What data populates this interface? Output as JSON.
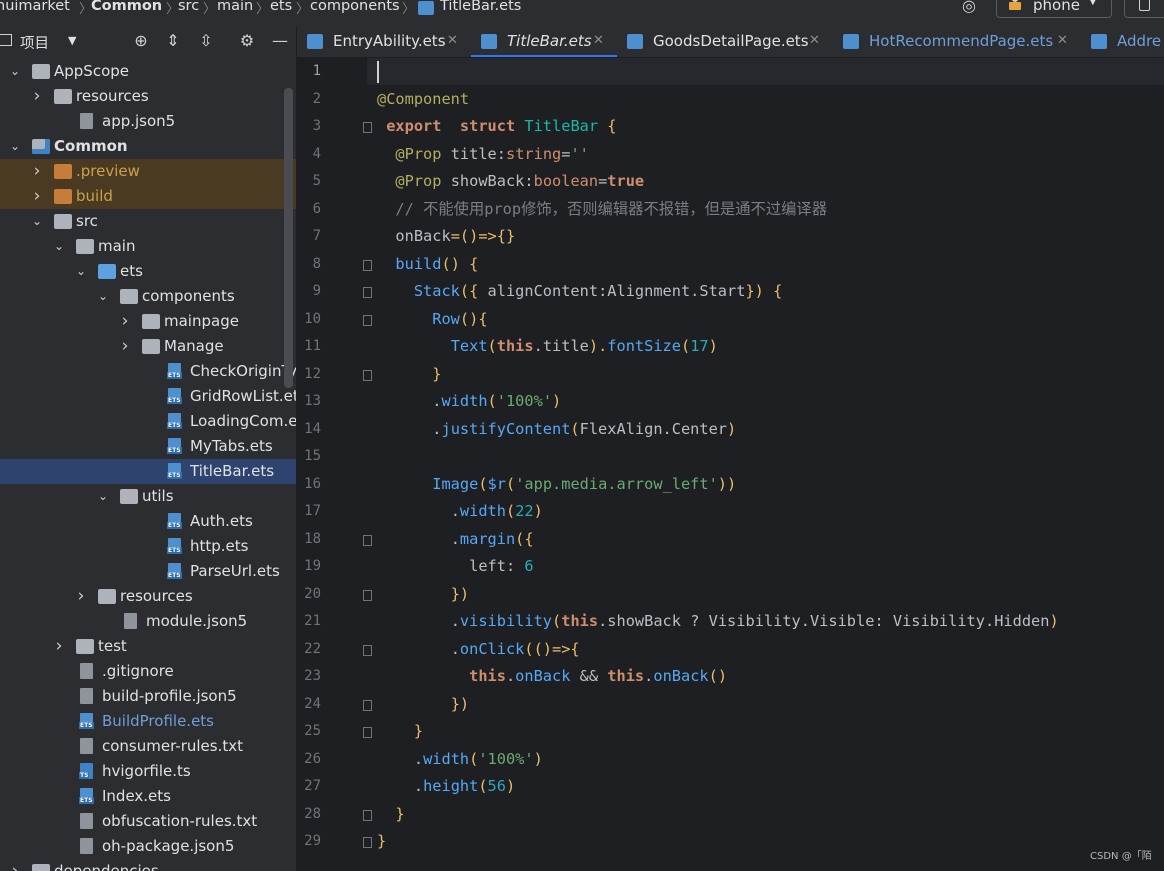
{
  "breadcrumb": [
    "huimarket",
    "Common",
    "src",
    "main",
    "ets",
    "components",
    "TitleBar.ets"
  ],
  "device": {
    "label": "phone"
  },
  "project_panel": {
    "title": "项目"
  },
  "tree": [
    {
      "label": "AppScope",
      "kind": "folder",
      "depth": 0,
      "open": true
    },
    {
      "label": "resources",
      "kind": "folder",
      "depth": 1,
      "open": false
    },
    {
      "label": "app.json5",
      "kind": "json",
      "depth": 1
    },
    {
      "label": "Common",
      "kind": "module",
      "depth": 0,
      "open": true,
      "bold": true
    },
    {
      "label": ".preview",
      "kind": "folder-orange",
      "depth": 1,
      "open": false
    },
    {
      "label": "build",
      "kind": "folder-orange",
      "depth": 1,
      "open": false
    },
    {
      "label": "src",
      "kind": "folder",
      "depth": 1,
      "open": true
    },
    {
      "label": "main",
      "kind": "folder",
      "depth": 2,
      "open": true
    },
    {
      "label": "ets",
      "kind": "folder-blue",
      "depth": 3,
      "open": true
    },
    {
      "label": "components",
      "kind": "folder",
      "depth": 4,
      "open": true
    },
    {
      "label": "mainpage",
      "kind": "folder",
      "depth": 5,
      "open": false
    },
    {
      "label": "Manage",
      "kind": "folder",
      "depth": 5,
      "open": false
    },
    {
      "label": "CheckOriginType",
      "kind": "ets",
      "depth": 5
    },
    {
      "label": "GridRowList.ets",
      "kind": "ets",
      "depth": 5
    },
    {
      "label": "LoadingCom.ets",
      "kind": "ets",
      "depth": 5
    },
    {
      "label": "MyTabs.ets",
      "kind": "ets",
      "depth": 5
    },
    {
      "label": "TitleBar.ets",
      "kind": "ets",
      "depth": 5,
      "selected": true
    },
    {
      "label": "utils",
      "kind": "folder",
      "depth": 4,
      "open": true
    },
    {
      "label": "Auth.ets",
      "kind": "ets",
      "depth": 5
    },
    {
      "label": "http.ets",
      "kind": "ets",
      "depth": 5
    },
    {
      "label": "ParseUrl.ets",
      "kind": "ets",
      "depth": 5
    },
    {
      "label": "resources",
      "kind": "folder",
      "depth": 3,
      "open": false
    },
    {
      "label": "module.json5",
      "kind": "json",
      "depth": 3
    },
    {
      "label": "test",
      "kind": "folder",
      "depth": 2,
      "open": false
    },
    {
      "label": ".gitignore",
      "kind": "txt",
      "depth": 1
    },
    {
      "label": "build-profile.json5",
      "kind": "json",
      "depth": 1
    },
    {
      "label": "BuildProfile.ets",
      "kind": "ets",
      "depth": 1,
      "blue": true
    },
    {
      "label": "consumer-rules.txt",
      "kind": "txt",
      "depth": 1
    },
    {
      "label": "hvigorfile.ts",
      "kind": "ts",
      "depth": 1
    },
    {
      "label": "Index.ets",
      "kind": "ets",
      "depth": 1
    },
    {
      "label": "obfuscation-rules.txt",
      "kind": "txt",
      "depth": 1
    },
    {
      "label": "oh-package.json5",
      "kind": "json",
      "depth": 1
    },
    {
      "label": "dependencies",
      "kind": "folder",
      "depth": 0,
      "open": false
    }
  ],
  "tabs": [
    {
      "label": "EntryAbility.ets",
      "active": false
    },
    {
      "label": "TitleBar.ets",
      "active": true
    },
    {
      "label": "GoodsDetailPage.ets",
      "active": false
    },
    {
      "label": "HotRecommendPage.ets",
      "active": false
    },
    {
      "label": "Addre",
      "active": false
    }
  ],
  "code": [
    "",
    "@Component",
    " export  struct TitleBar {",
    "  @Prop title:string=''",
    "  @Prop showBack:boolean=true",
    "  // 不能使用prop修饰，否则编辑器不报错，但是通不过编译器",
    "  onBack=()=>{}",
    "  build() {",
    "    Stack({ alignContent:Alignment.Start}) {",
    "      Row(){",
    "        Text(this.title).fontSize(17)",
    "      }",
    "      .width('100%')",
    "      .justifyContent(FlexAlign.Center)",
    "",
    "      Image($r('app.media.arrow_left'))",
    "        .width(22)",
    "        .margin({",
    "          left: 6",
    "        })",
    "        .visibility(this.showBack ? Visibility.Visible: Visibility.Hidden)",
    "        .onClick(()=>{",
    "          this.onBack && this.onBack()",
    "        })",
    "    }",
    "    .width('100%')",
    "    .height(56)",
    "  }",
    "}"
  ],
  "colors": {
    "keyword": "#cf8e6d",
    "annotation": "#b3ae60",
    "function": "#56a8f5",
    "string": "#6aab73",
    "number": "#2aacb8",
    "comment": "#7a7e85",
    "purple": "#c77dbb",
    "type": "#16baac"
  },
  "watermark": "CSDN @「陌"
}
